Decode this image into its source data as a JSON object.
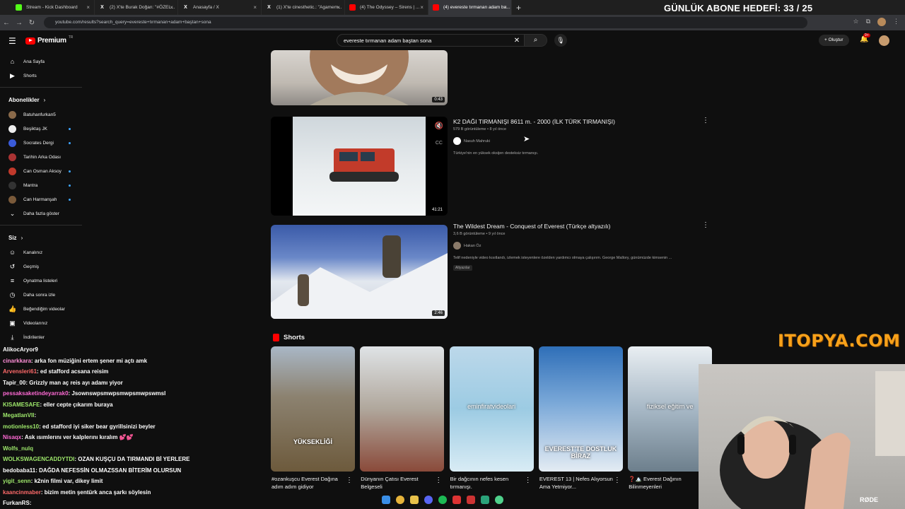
{
  "browser": {
    "tabs": [
      {
        "title": "Stream - Kick Dashboard",
        "icon": "kick-icon",
        "color": "#53fc18"
      },
      {
        "title": "(2) X'te Burak Doğan: \"#ÖZEL...",
        "icon": "x-icon",
        "color": "#ffffff"
      },
      {
        "title": "Anasayfa / X",
        "icon": "x-icon",
        "color": "#ffffff"
      },
      {
        "title": "(1) X'te cinesthetic.: \"Agamem...",
        "icon": "x-icon",
        "color": "#ffffff"
      },
      {
        "title": "(4) The Odyssey – Sirens | ...",
        "icon": "youtube-icon",
        "color": "#ff0000"
      },
      {
        "title": "(4) evereste tırmanan adam ba...",
        "icon": "youtube-icon",
        "color": "#ff0000"
      }
    ],
    "url": "youtube.com/results?search_query=evereste+tırmanan+adam+baştan+sona"
  },
  "overlay": {
    "goal": "GÜNLÜK ABONE HEDEFİ: 33 / 25",
    "sponsor": "ITOPYA.COM"
  },
  "youtube": {
    "logo": "Premium",
    "logo_region": "TR",
    "search_query": "evereste tırmanan adam baştan sona",
    "create_label": "Oluştur",
    "notif_count": "9+"
  },
  "sidebar": {
    "main": [
      {
        "label": "Ana Sayfa",
        "icon": "home-icon"
      },
      {
        "label": "Shorts",
        "icon": "shorts-icon"
      }
    ],
    "subs_title": "Abonelikler",
    "subs": [
      {
        "label": "Batuhanfurkan5",
        "color": "#8a6a4a",
        "dot": false
      },
      {
        "label": "Beşiktaş JK",
        "color": "#eeeeee",
        "dot": true
      },
      {
        "label": "Socrates Dergi",
        "color": "#3a5bd9",
        "dot": true
      },
      {
        "label": "Tarihin Arka Odası",
        "color": "#a33",
        "dot": false
      },
      {
        "label": "Can Osman Aksoy",
        "color": "#c0392b",
        "dot": true
      },
      {
        "label": "Mantra",
        "color": "#333333",
        "dot": true
      },
      {
        "label": "Can Harmanşah",
        "color": "#7a5a3a",
        "dot": true
      }
    ],
    "more": "Daha fazla göster",
    "you_title": "Siz",
    "you": [
      {
        "label": "Kanalınız",
        "icon": "channel-icon"
      },
      {
        "label": "Geçmiş",
        "icon": "history-icon"
      },
      {
        "label": "Oynatma listeleri",
        "icon": "playlist-icon"
      },
      {
        "label": "Daha sonra izle",
        "icon": "clock-icon"
      },
      {
        "label": "Beğendiğim videolar",
        "icon": "like-icon"
      },
      {
        "label": "Videolarınız",
        "icon": "video-icon"
      },
      {
        "label": "İndirilenler",
        "icon": "download-icon"
      }
    ]
  },
  "videos": [
    {
      "duration": "0:43"
    },
    {
      "title": "K2 DAĞI TIRMANIŞI 8611 m. - 2000 (İLK TÜRK TIRMANIŞI)",
      "meta": "579 B görüntüleme • 8 yıl önce",
      "channel": "Nasuh Mahruki",
      "desc": "Türkiye'nin en yüksek oksijen desteksiz tırmanışı.",
      "duration": "41:21"
    },
    {
      "title": "The Wildest Dream - Conquest of Everest (Türkçe altyazılı)",
      "meta": "3,6 B görüntüleme • 9 yıl önce",
      "channel": "Hakan Öz",
      "desc": "Telif nedeniyle video kısıtlandı, izlemek isteyenlere özelden yardımcı olmaya çalışırım. George Mallory, günümüzde kimsenin ...",
      "tag": "Altyazılar",
      "duration": "2:46"
    }
  ],
  "shorts": {
    "title": "Shorts",
    "items": [
      {
        "title": "#ozankuşcu Everest Dağına adım adım gidiyor",
        "caption": "YÜKSEKLİĞİ"
      },
      {
        "title": "Dünyanın Çatısı Everest Belgeseli",
        "caption": ""
      },
      {
        "title": "Bir dağcının nefes kesen tırmanışı.",
        "caption": "eminfiratvideolari"
      },
      {
        "title": "EVEREST 13 | Nefes Alıyorsun Ama Yetmiyor...",
        "caption": "EVEREST'TE DOSTLUK BİRAZ"
      },
      {
        "title": "❓🏔️ Everest Dağının Bilinmeyenleri",
        "caption": "fiziksel eğitim ve"
      }
    ]
  },
  "chat": [
    {
      "user": "AlikocAryor9",
      "text": "",
      "color": "#ffffff"
    },
    {
      "user": "cinarkkara",
      "text": ": arka fon müziğini ertem şener mi açtı amk",
      "color": "#ff8fd8"
    },
    {
      "user": "Arvensleri61",
      "text": ": ed stafford acsana reisim",
      "color": "#ff6a6a"
    },
    {
      "user": "Tapir_00",
      "text": ": Grizzly man aç reis ayı adamı yiyor",
      "color": "#ffffff"
    },
    {
      "user": "pessaksaketindeyarrak0",
      "text": ": Jsownswpsmwpsmwpsmwpswmsl",
      "color": "#ff6ad5"
    },
    {
      "user": "KISAMESAFE",
      "text": ": eller cepte çıkarım buraya",
      "color": "#9ee86b"
    },
    {
      "user": "MegatlanVII",
      "text": ":",
      "color": "#9ee86b"
    },
    {
      "user": "motionless10",
      "text": ": ed stafford iyi siker bear gyrillsinizi beyler",
      "color": "#9ee86b"
    },
    {
      "user": "Nisaqx",
      "text": ": Ask ısımlerını ver kalplerını kıralım 💕💕",
      "color": "#ff6ad5"
    },
    {
      "user": "Wolfs_nulq",
      "text": "",
      "color": "#9ee86b"
    },
    {
      "user": "WOLKSWAGENCADDYTDI",
      "text": ": OZAN KUŞÇU DA TIRMANDI Bİ YERLERE",
      "color": "#9ee86b"
    },
    {
      "user": "bedobaba11",
      "text": ": DAĞDA NEFESSİN OLMAZSSAN BİTERİM OLURSUN",
      "color": "#ffffff"
    },
    {
      "user": "yigit_senn",
      "text": ": k2nin filmi var, dikey limit",
      "color": "#9ee86b"
    },
    {
      "user": "kaancinmaber",
      "text": ": bizim metin şentürk anca şarkı söylesin",
      "color": "#ff6a6a"
    },
    {
      "user": "FurkanRS",
      "text": ":",
      "color": "#ffffff"
    }
  ]
}
